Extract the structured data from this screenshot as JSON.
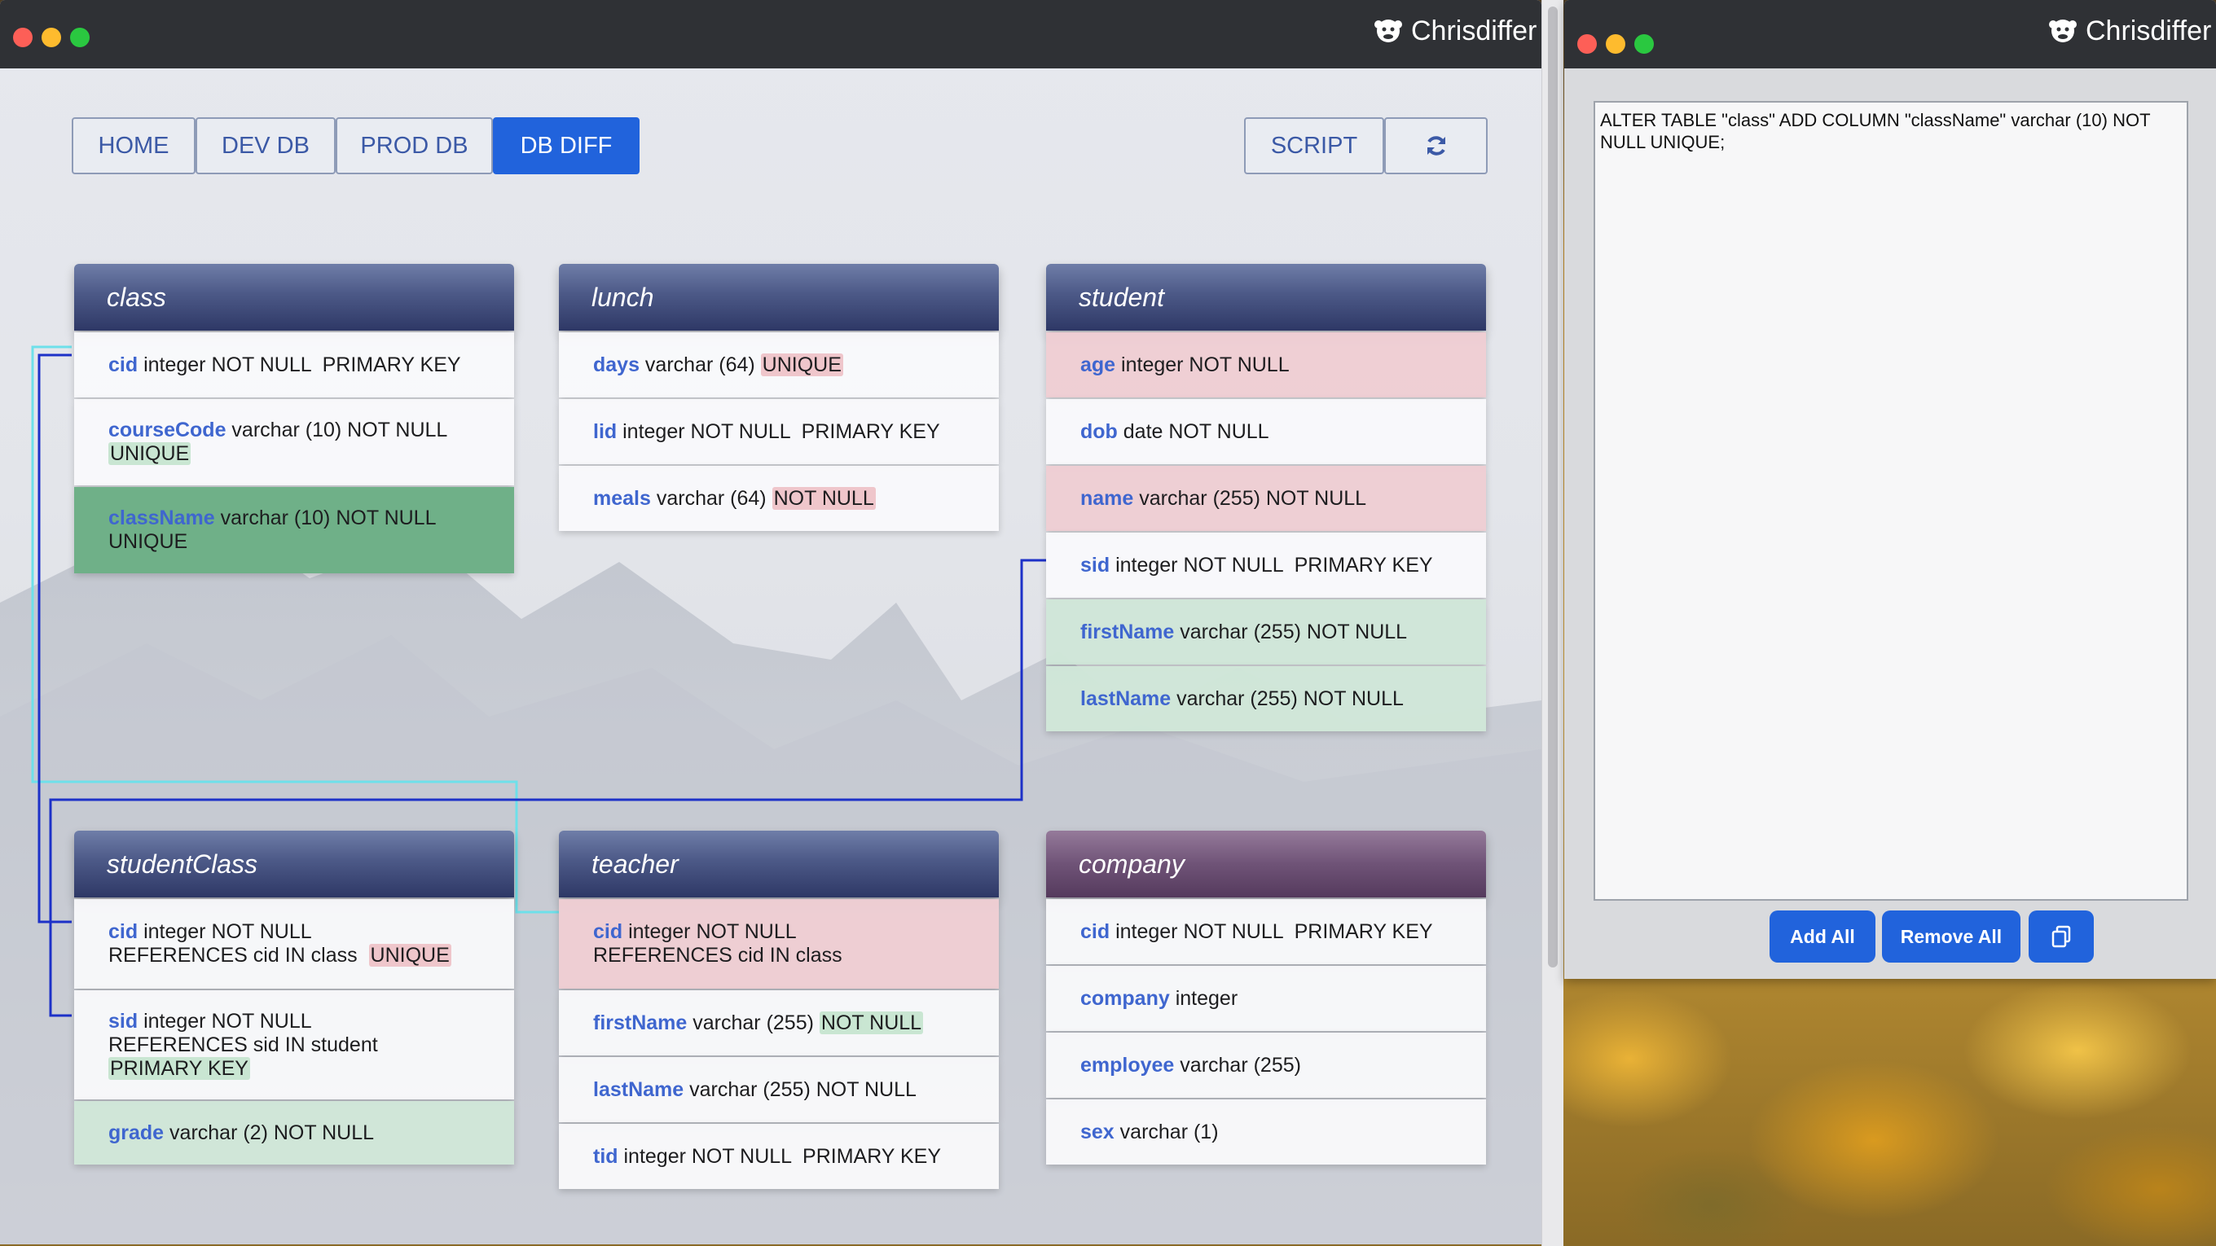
{
  "app": {
    "title": "Chrisdiffer"
  },
  "nav": {
    "home": "HOME",
    "dev_db": "DEV DB",
    "prod_db": "PROD DB",
    "db_diff": "DB DIFF",
    "script": "SCRIPT",
    "refresh_icon": "refresh-icon"
  },
  "colors": {
    "accent": "#2163dc",
    "header": "#3d4877",
    "company_header": "#6a5174",
    "added": "#6fb088",
    "missing": "#eecdd3",
    "new_field": "#d0e6d8"
  },
  "tables": {
    "class": {
      "name": "class",
      "rows": [
        {
          "col": "cid",
          "lines": [
            " integer NOT NULL  PRIMARY KEY"
          ]
        },
        {
          "col": "courseCode",
          "lines": [
            " varchar (10) NOT NULL"
          ],
          "extra": "UNIQUE"
        },
        {
          "col": "className",
          "lines": [
            " varchar (10) NOT NULL",
            "UNIQUE"
          ]
        }
      ]
    },
    "lunch": {
      "name": "lunch",
      "rows": [
        {
          "col": "days",
          "text": " varchar (64) ",
          "badge": "UNIQUE"
        },
        {
          "col": "lid",
          "text": " integer NOT NULL  PRIMARY KEY"
        },
        {
          "col": "meals",
          "text": " varchar (64) ",
          "badge": "NOT NULL"
        }
      ]
    },
    "student": {
      "name": "student",
      "rows": [
        {
          "col": "age",
          "text": " integer NOT NULL"
        },
        {
          "col": "dob",
          "text": " date NOT NULL"
        },
        {
          "col": "name",
          "text": " varchar (255) NOT NULL"
        },
        {
          "col": "sid",
          "text": " integer NOT NULL  PRIMARY KEY"
        },
        {
          "col": "firstName",
          "text": " varchar (255) NOT NULL"
        },
        {
          "col": "lastName",
          "text": " varchar (255) NOT NULL"
        }
      ]
    },
    "studentClass": {
      "name": "studentClass",
      "rows": [
        {
          "col": "cid",
          "line1": " integer NOT NULL",
          "line2": "REFERENCES cid IN class  ",
          "badge": "UNIQUE"
        },
        {
          "col": "sid",
          "line1": " integer NOT NULL",
          "line2": "REFERENCES sid IN student",
          "badge": "PRIMARY KEY"
        },
        {
          "col": "grade",
          "text": " varchar (2) NOT NULL"
        }
      ]
    },
    "teacher": {
      "name": "teacher",
      "rows": [
        {
          "col": "cid",
          "line1": " integer NOT NULL",
          "line2": "REFERENCES cid IN class"
        },
        {
          "col": "firstName",
          "text": " varchar (255) ",
          "badge": "NOT NULL"
        },
        {
          "col": "lastName",
          "text": " varchar (255) NOT NULL"
        },
        {
          "col": "tid",
          "text": " integer NOT NULL  PRIMARY KEY"
        }
      ]
    },
    "company": {
      "name": "company",
      "rows": [
        {
          "col": "cid",
          "text": " integer NOT NULL  PRIMARY KEY"
        },
        {
          "col": "company",
          "text": " integer"
        },
        {
          "col": "employee",
          "text": " varchar (255)"
        },
        {
          "col": "sex",
          "text": " varchar (1)"
        }
      ]
    }
  },
  "script_panel": {
    "title": "Chrisdiffer",
    "script_text": "ALTER TABLE \"class\" ADD COLUMN \"className\" varchar (10) NOT NULL UNIQUE;",
    "add_all": "Add All",
    "remove_all": "Remove All",
    "copy_icon": "copy-icon"
  }
}
